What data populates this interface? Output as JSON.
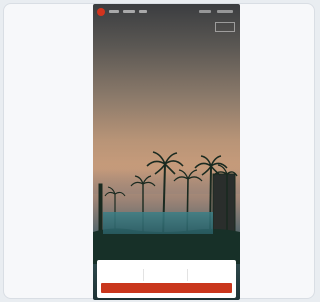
{
  "nav": {
    "links": [
      "",
      "",
      ""
    ],
    "right": [
      "",
      ""
    ]
  },
  "hero": {
    "headline": "",
    "subline": ""
  },
  "booking": {
    "title": "",
    "link": "",
    "fields": [
      {
        "label": "",
        "value": ""
      },
      {
        "label": "",
        "value": ""
      },
      {
        "label": "",
        "value": ""
      }
    ],
    "cta_label": ""
  },
  "colors": {
    "brand": "#d2341e",
    "cta": "#c9371d"
  },
  "icons": {
    "logo": "brand-logo-icon"
  }
}
